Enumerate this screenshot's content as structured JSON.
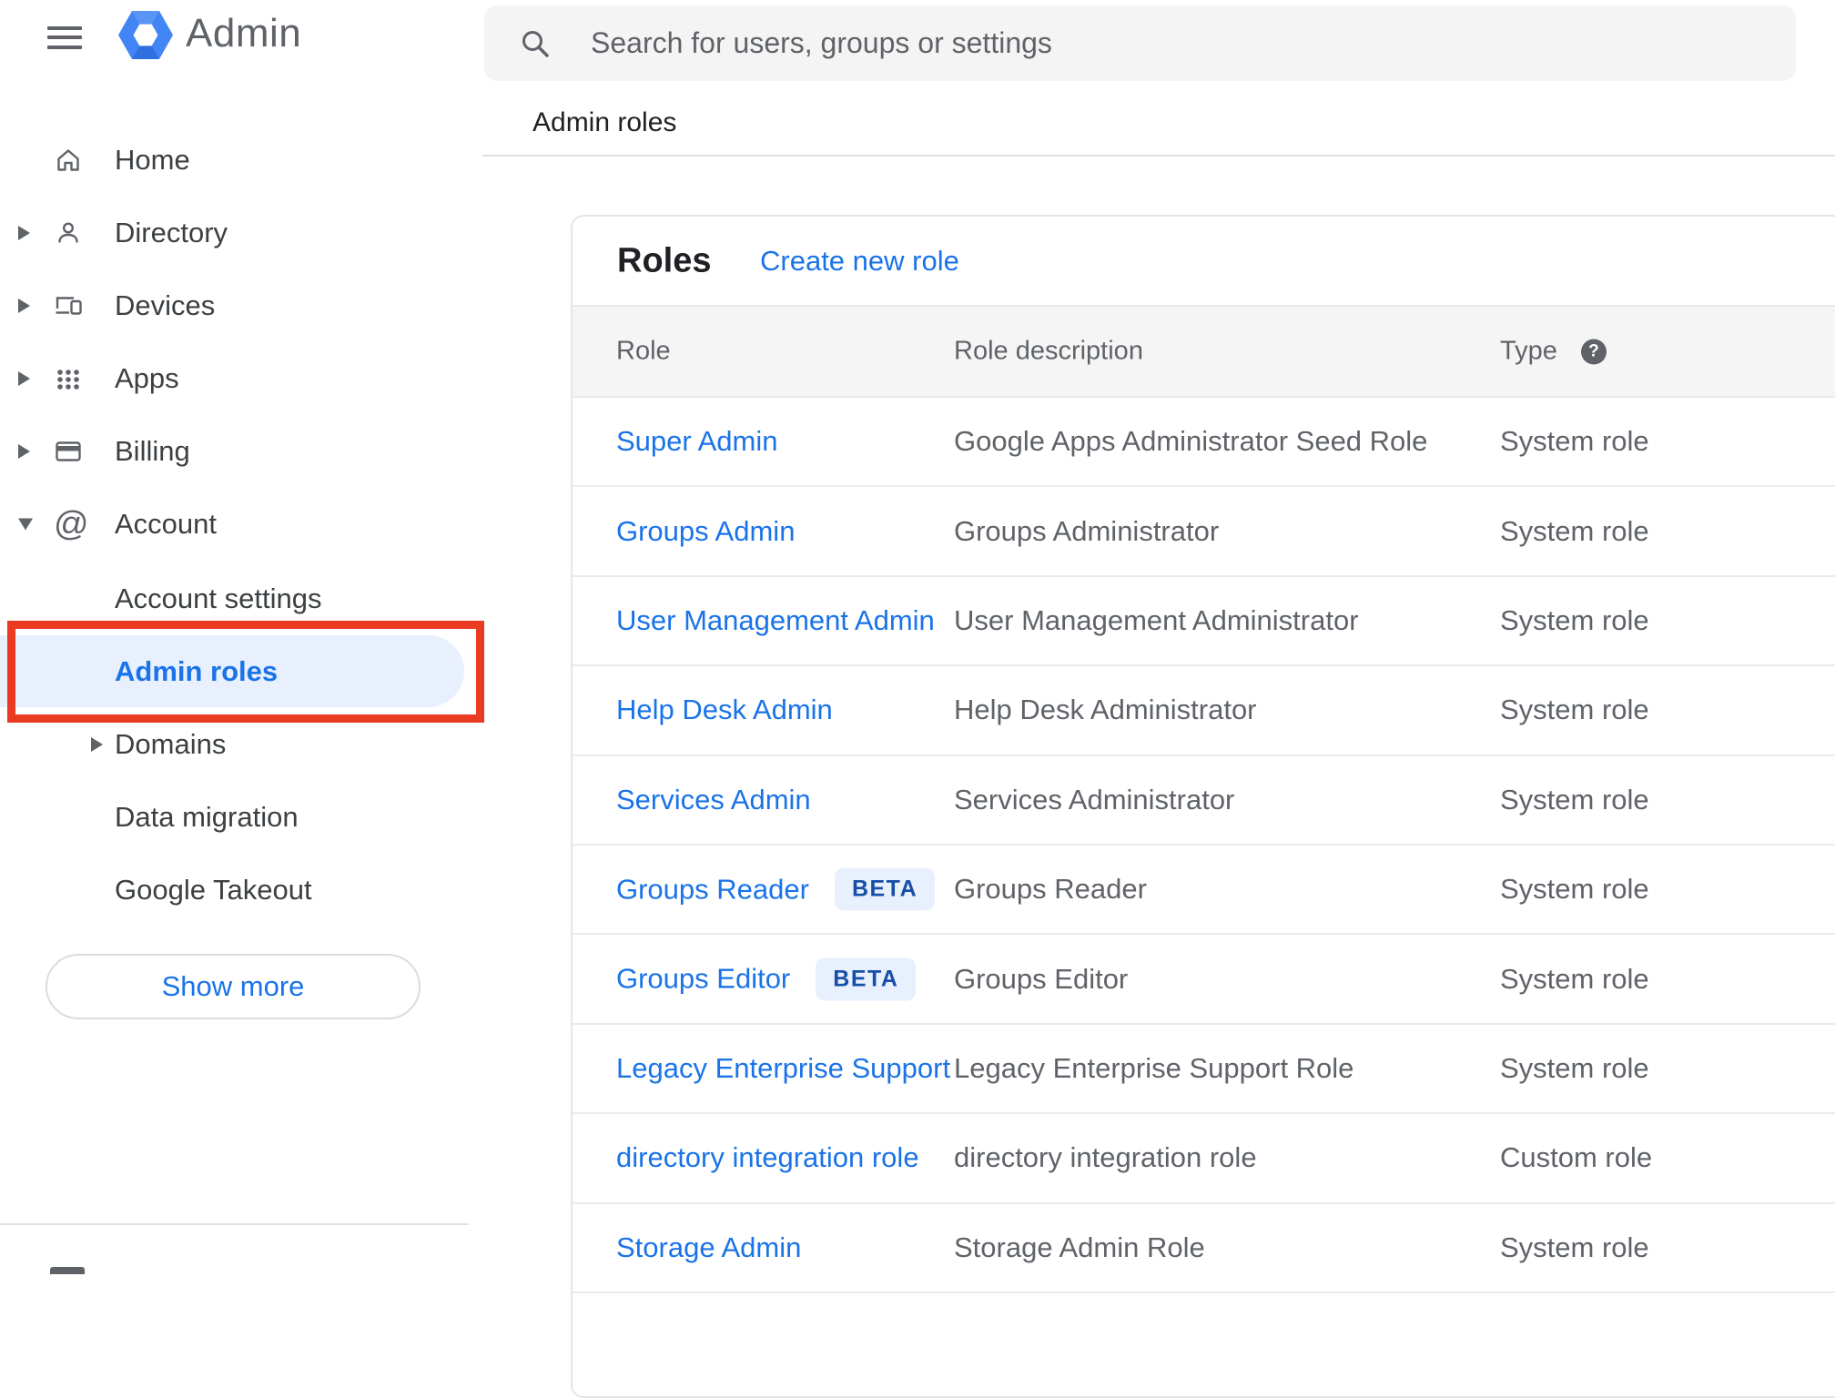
{
  "app": {
    "brand": "Admin"
  },
  "search": {
    "placeholder": "Search for users, groups or settings"
  },
  "breadcrumb": "Admin roles",
  "sidebar": {
    "items": [
      {
        "label": "Home",
        "icon": "home",
        "expander": "none"
      },
      {
        "label": "Directory",
        "icon": "person",
        "expander": "collapsed"
      },
      {
        "label": "Devices",
        "icon": "devices",
        "expander": "collapsed"
      },
      {
        "label": "Apps",
        "icon": "apps-grid",
        "expander": "collapsed"
      },
      {
        "label": "Billing",
        "icon": "credit-card",
        "expander": "collapsed"
      },
      {
        "label": "Account",
        "icon": "at-sign",
        "expander": "expanded"
      }
    ],
    "account_children": [
      {
        "label": "Account settings",
        "selected": false
      },
      {
        "label": "Admin roles",
        "selected": true
      },
      {
        "label": "Domains",
        "selected": false,
        "expander": "collapsed"
      },
      {
        "label": "Data migration",
        "selected": false
      },
      {
        "label": "Google Takeout",
        "selected": false
      }
    ],
    "show_more_label": "Show more"
  },
  "roles_card": {
    "title": "Roles",
    "create_link": "Create new role",
    "columns": [
      "Role",
      "Role description",
      "Type"
    ],
    "beta_label": "BETA",
    "rows": [
      {
        "role": "Super Admin",
        "beta": false,
        "description": "Google Apps Administrator Seed Role",
        "type": "System role"
      },
      {
        "role": "Groups Admin",
        "beta": false,
        "description": "Groups Administrator",
        "type": "System role"
      },
      {
        "role": "User Management Admin",
        "beta": false,
        "description": "User Management Administrator",
        "type": "System role"
      },
      {
        "role": "Help Desk Admin",
        "beta": false,
        "description": "Help Desk Administrator",
        "type": "System role"
      },
      {
        "role": "Services Admin",
        "beta": false,
        "description": "Services Administrator",
        "type": "System role"
      },
      {
        "role": "Groups Reader",
        "beta": true,
        "description": "Groups Reader",
        "type": "System role"
      },
      {
        "role": "Groups Editor",
        "beta": true,
        "description": "Groups Editor",
        "type": "System role"
      },
      {
        "role": "Legacy Enterprise Support",
        "beta": false,
        "description": "Legacy Enterprise Support Role",
        "type": "System role"
      },
      {
        "role": "directory integration role",
        "beta": false,
        "description": "directory integration role",
        "type": "Custom role"
      },
      {
        "role": "Storage Admin",
        "beta": false,
        "description": "Storage Admin Role",
        "type": "System role"
      }
    ]
  },
  "icons": {
    "help_glyph": "?"
  },
  "colors": {
    "link_blue": "#1a73e8",
    "selected_pill_bg": "#e8f0fe",
    "beta_bg": "#e8f0fe",
    "beta_text": "#174ea6",
    "annotation_red": "#ea3a21",
    "text_dark": "#202124",
    "text_gray": "#5f6368",
    "header_band": "#f5f5f5",
    "search_bg": "#f4f4f4"
  }
}
